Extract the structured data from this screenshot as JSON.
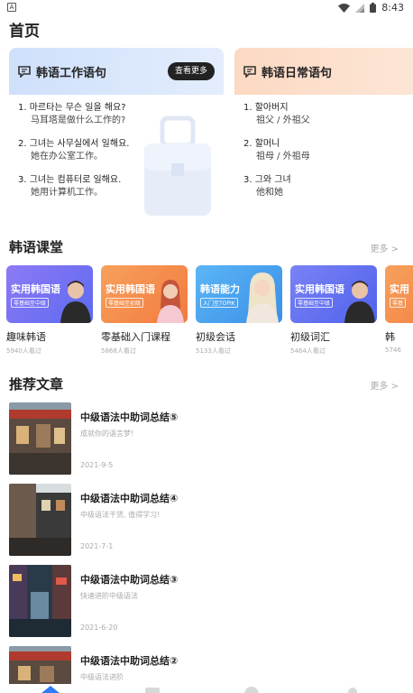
{
  "status_bar": {
    "time": "8:43",
    "left_icon_label": "A",
    "icons": [
      "wifi-icon",
      "signal-icon",
      "battery-icon"
    ]
  },
  "page_title": "首页",
  "sentence_cards": [
    {
      "title": "韩语工作语句",
      "more_label": "查看更多",
      "theme_color": "#cfe0fb",
      "sentences": [
        {
          "ko": "1. 마르타는 무슨 일을 해요?",
          "zh": "马耳塔是做什么工作的?"
        },
        {
          "ko": "2. 그녀는 사무실에서 일해요.",
          "zh": "她在办公室工作。"
        },
        {
          "ko": "3. 그녀는 컴퓨터로 일해요.",
          "zh": "她用计算机工作。"
        }
      ]
    },
    {
      "title": "韩语日常语句",
      "more_label": "查",
      "theme_color": "#fcd9c2",
      "sentences": [
        {
          "ko": "1. 할아버지",
          "zh": "祖父 / 外祖父"
        },
        {
          "ko": "2. 할머니",
          "zh": "祖母 / 外祖母"
        },
        {
          "ko": "3. 그와 그녀",
          "zh": "他和她"
        }
      ]
    }
  ],
  "classroom": {
    "title": "韩语课堂",
    "more_label": "更多 >",
    "courses": [
      {
        "thumb_title": "实用韩国语",
        "thumb_tag": "零基础至中级",
        "name": "趣味韩语",
        "views": "5940人看过",
        "bg": "#7b6cf0"
      },
      {
        "thumb_title": "实用韩国语",
        "thumb_tag": "零基础至初级",
        "name": "零基础入门课程",
        "views": "5868人看过",
        "bg": "#f6894a"
      },
      {
        "thumb_title": "韩语能力",
        "thumb_tag": "入门至TOPIK",
        "name": "初级会话",
        "views": "5133人看过",
        "bg": "#4aa9f0"
      },
      {
        "thumb_title": "实用韩国语",
        "thumb_tag": "零基础至中级",
        "name": "初级词汇",
        "views": "5464人看过",
        "bg": "#6a72f0"
      },
      {
        "thumb_title": "实用",
        "thumb_tag": "零基",
        "name": "韩",
        "views": "5746",
        "bg": "#f6894a"
      }
    ]
  },
  "articles": {
    "title": "推荐文章",
    "more_label": "更多 >",
    "items": [
      {
        "title": "中级语法中助词总结⑤",
        "subtitle": "成就你的语言梦!",
        "date": "2021-9-5"
      },
      {
        "title": "中级语法中助词总结④",
        "subtitle": "中级语法干货, 值得学习!",
        "date": "2021-7-1"
      },
      {
        "title": "中级语法中助词总结③",
        "subtitle": "快速进阶中级语法",
        "date": "2021-6-20"
      },
      {
        "title": "中级语法中助词总结②",
        "subtitle": "中级语法进阶",
        "date": ""
      }
    ]
  },
  "tab_bar": {
    "active_color": "#2f7cf6",
    "icons": [
      "home-icon",
      "message-icon",
      "explore-icon",
      "profile-icon"
    ]
  }
}
